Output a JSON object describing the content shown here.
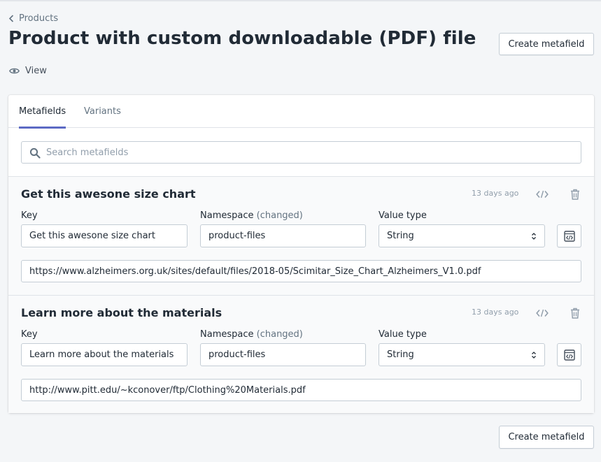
{
  "breadcrumb": {
    "label": "Products",
    "icon": "chevron-left-icon"
  },
  "page": {
    "title": "Product with custom downloadable (PDF) file",
    "view_label": "View",
    "create_metafield_label": "Create metafield"
  },
  "tabs": [
    {
      "label": "Metafields",
      "active": true
    },
    {
      "label": "Variants",
      "active": false
    }
  ],
  "search": {
    "placeholder": "Search metafields",
    "value": ""
  },
  "labels": {
    "key": "Key",
    "namespace": "Namespace",
    "namespace_changed": "(changed)",
    "value_type": "Value type"
  },
  "metafields": [
    {
      "title": "Get this awesone size chart",
      "updated": "13 days ago",
      "key": "Get this awesone size chart",
      "namespace": "product-files",
      "value_type": "String",
      "value": "https://www.alzheimers.org.uk/sites/default/files/2018-05/Scimitar_Size_Chart_Alzheimers_V1.0.pdf"
    },
    {
      "title": "Learn more about the materials",
      "updated": "13 days ago",
      "key": "Learn more about the materials",
      "namespace": "product-files",
      "value_type": "String",
      "value": "http://www.pitt.edu/~kconover/ftp/Clothing%20Materials.pdf"
    }
  ],
  "colors": {
    "background": "#f4f6f8",
    "text": "#212b36",
    "muted": "#637381",
    "active_tab_underline": "#5c6ac4",
    "border": "#c4cdd5"
  }
}
